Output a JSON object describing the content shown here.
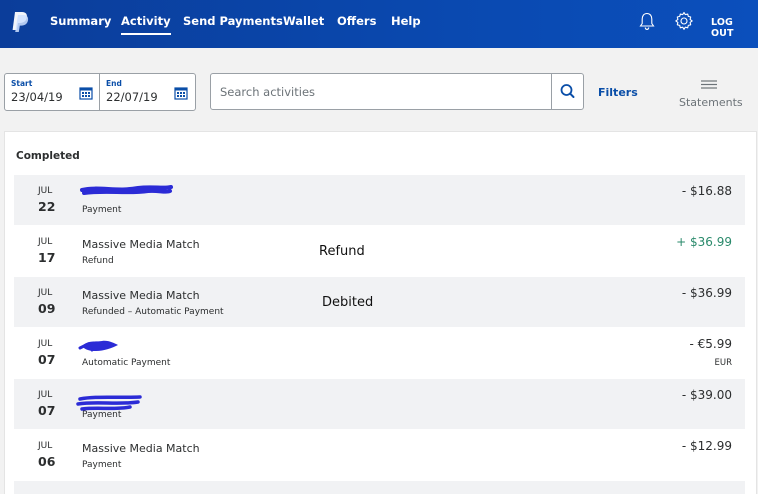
{
  "nav": {
    "items": [
      {
        "label": "Summary"
      },
      {
        "label": "Activity"
      },
      {
        "label": "Send Payments"
      },
      {
        "label": "Wallet"
      },
      {
        "label": "Offers"
      },
      {
        "label": "Help"
      }
    ],
    "active": "Activity",
    "logout_label": "LOG OUT",
    "logo_icon": "paypal-logo-icon",
    "bell_icon": "bell-icon",
    "settings_icon": "gear-icon"
  },
  "filters": {
    "start_label": "Start",
    "start_value": "23/04/19",
    "end_label": "End",
    "end_value": "22/07/19",
    "calendar_icon": "calendar-icon",
    "search_placeholder": "Search activities",
    "search_icon": "search-icon",
    "filters_label": "Filters",
    "statements_label": "Statements",
    "statements_icon": "menu-lines-icon"
  },
  "colors": {
    "nav_bg": "#0b45a8",
    "link": "#0a4ea8",
    "positive": "#2a8a6b",
    "row_alt": "#f1f2f4",
    "redaction": "#2b2bd6"
  },
  "activity": {
    "section_title": "Completed",
    "transactions": [
      {
        "month": "JUL",
        "day": "22",
        "name": "",
        "type": "Payment",
        "amount": "- $16.88",
        "currency": "",
        "redacted": true
      },
      {
        "month": "JUL",
        "day": "17",
        "name": "Massive Media Match",
        "type": "Refund",
        "amount": "+ $36.99",
        "currency": "",
        "redacted": false,
        "note": "Refund"
      },
      {
        "month": "JUL",
        "day": "09",
        "name": "Massive Media Match",
        "type": "Refunded – Automatic Payment",
        "amount": "- $36.99",
        "currency": "",
        "redacted": false,
        "note": "Debited"
      },
      {
        "month": "JUL",
        "day": "07",
        "name": "",
        "type": "Automatic Payment",
        "amount": "- €5.99",
        "currency": "EUR",
        "redacted": true
      },
      {
        "month": "JUL",
        "day": "07",
        "name": "",
        "type": "Payment",
        "amount": "- $39.00",
        "currency": "",
        "redacted": true
      },
      {
        "month": "JUL",
        "day": "06",
        "name": "Massive Media Match",
        "type": "Payment",
        "amount": "- $12.99",
        "currency": "",
        "redacted": false
      }
    ]
  }
}
